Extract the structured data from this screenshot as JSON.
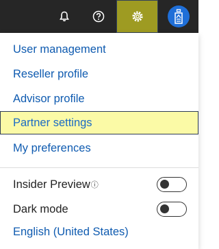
{
  "topbar": {
    "icons": [
      "bell-icon",
      "help-icon",
      "gear-icon",
      "user-avatar-icon"
    ],
    "active_icon": "gear-icon",
    "background": "#262626",
    "active_background": "#9e9b22"
  },
  "menu": {
    "items": [
      {
        "label": "User management"
      },
      {
        "label": "Reseller profile"
      },
      {
        "label": "Advisor profile"
      },
      {
        "label": "Partner settings",
        "highlighted": true
      },
      {
        "label": "My preferences"
      }
    ],
    "toggles": [
      {
        "label": "Insider Preview",
        "info_icon": "info-icon",
        "state": "off"
      },
      {
        "label": "Dark mode",
        "state": "off"
      }
    ],
    "language": "English (United States)",
    "link_color": "#0f5bb0",
    "highlight_color": "#fbfaa6"
  }
}
